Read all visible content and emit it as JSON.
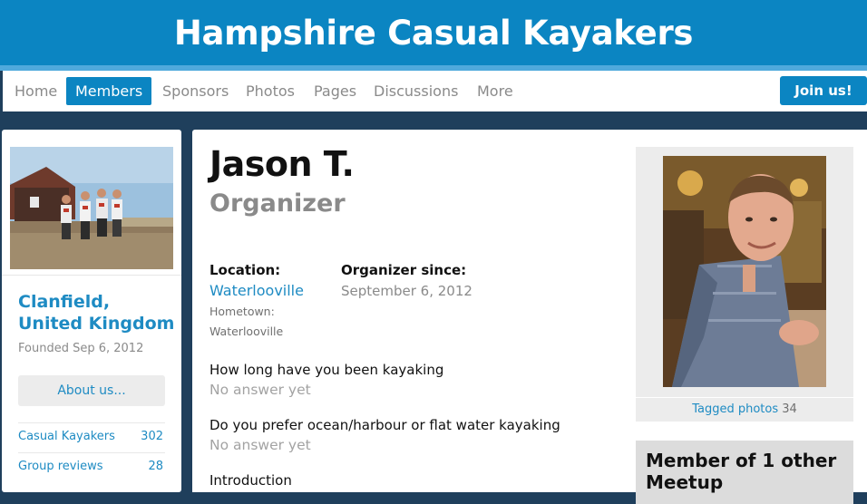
{
  "group": {
    "title": "Hampshire Casual Kayakers"
  },
  "nav": {
    "items": [
      "Home",
      "Members",
      "Sponsors",
      "Photos",
      "Pages",
      "Discussions",
      "More"
    ],
    "active": "Members",
    "join_label": "Join us!"
  },
  "sidebar": {
    "city_line1": "Clanfield,",
    "city_line2": "United Kingdom",
    "founded": "Founded Sep 6, 2012",
    "about_label": "About us...",
    "stats": [
      {
        "label": "Casual Kayakers",
        "count": "302"
      },
      {
        "label": "Group reviews",
        "count": "28"
      }
    ]
  },
  "profile": {
    "name": "Jason T.",
    "role": "Organizer",
    "location_label": "Location:",
    "location_value": "Waterlooville",
    "hometown_label": "Hometown:",
    "hometown_value": "Waterlooville",
    "since_label": "Organizer since:",
    "since_value": "September 6, 2012",
    "questions": [
      {
        "q": "How long have you been kayaking",
        "a": "No answer yet"
      },
      {
        "q": "Do you prefer ocean/harbour or flat water kayaking",
        "a": "No answer yet"
      }
    ],
    "intro_label": "Introduction",
    "tagged_label": "Tagged photos",
    "tagged_count": "34",
    "other_meetups": "Member of 1 other Meetup"
  },
  "colors": {
    "brand": "#0b85c2",
    "link": "#1e8bc3",
    "page_bg": "#1f3f5c"
  }
}
